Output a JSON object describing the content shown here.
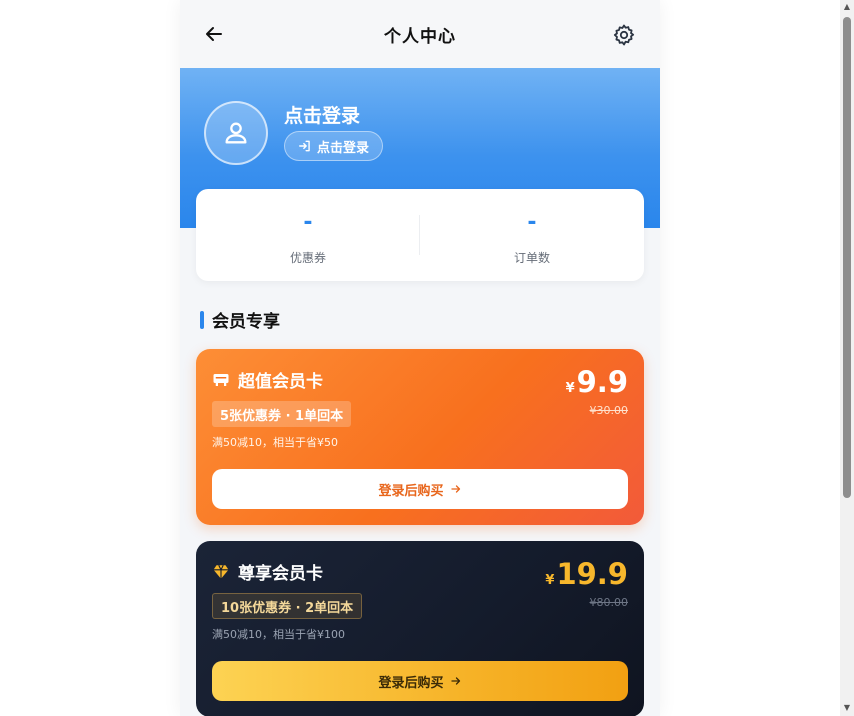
{
  "header": {
    "title": "个人中心",
    "back_icon": "arrow-left-icon",
    "settings_icon": "gear-icon"
  },
  "profile": {
    "avatar_icon": "user-icon",
    "name": "点击登录",
    "login_button": "点击登录",
    "login_icon": "login-icon"
  },
  "stats": [
    {
      "value": "-",
      "label": "优惠券"
    },
    {
      "value": "-",
      "label": "订单数"
    }
  ],
  "section": {
    "title": "会员专享"
  },
  "cards": [
    {
      "icon": "card-icon",
      "name": "超值会员卡",
      "tag": "5张优惠券 · 1单回本",
      "desc": "满50减10，相当于省¥50",
      "currency": "¥",
      "price": "9.9",
      "original_price": "¥30.00",
      "buy_label": "登录后购买",
      "accent": "#f8701e"
    },
    {
      "icon": "diamond-icon",
      "name": "尊享会员卡",
      "tag": "10张优惠券 · 2单回本",
      "desc": "满50减10，相当于省¥100",
      "currency": "¥",
      "price": "19.9",
      "original_price": "¥80.00",
      "buy_label": "登录后购买",
      "accent": "#f7b72c"
    }
  ],
  "colors": {
    "primary": "#2a86ec",
    "orange": "#f8701e",
    "gold": "#f7b72c",
    "dark": "#141b2b"
  }
}
